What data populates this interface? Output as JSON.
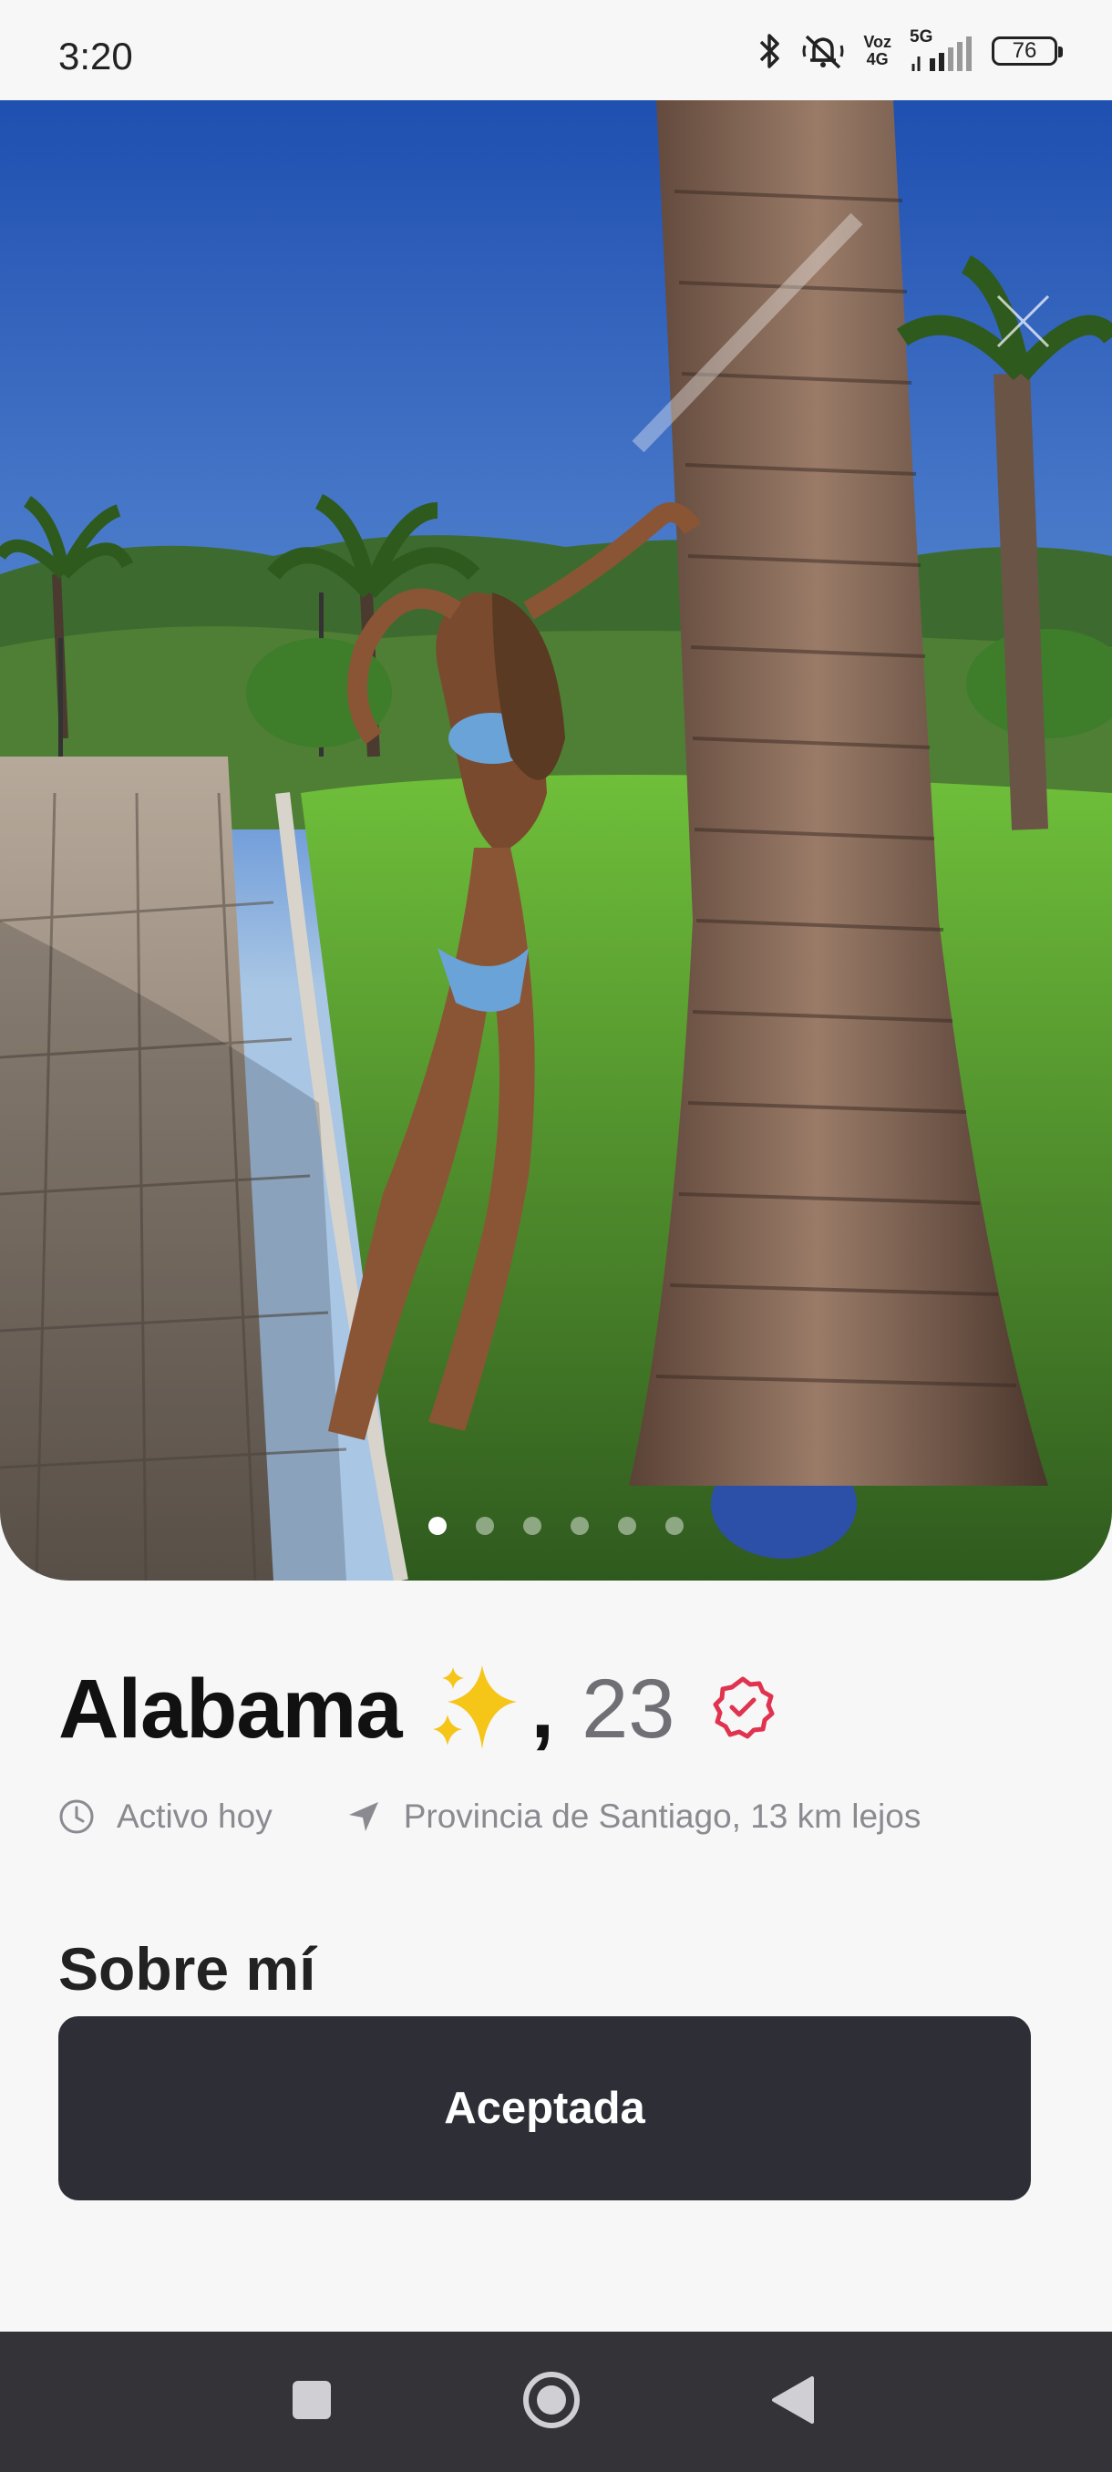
{
  "status_bar": {
    "time": "3:20",
    "network_label_top": "Voz",
    "network_label_bottom": "4G",
    "network_5g": "5G",
    "battery": "76",
    "icons": [
      "bluetooth-icon",
      "mute-icon",
      "signal-icon",
      "battery-icon"
    ]
  },
  "photo": {
    "description_icon": "photo",
    "page_count": 6,
    "active_page": 1
  },
  "profile": {
    "name": "Alabama",
    "emoji": "✨",
    "comma": ",",
    "age": "23",
    "verified_icon": "verified-badge-icon",
    "active": "Activo hoy",
    "location": "Provincia de Santiago, 13 km lejos"
  },
  "about": {
    "title": "Sobre mí",
    "button_label": "Aceptada"
  },
  "colors": {
    "background": "#f7f7f8",
    "button": "#2e2e37",
    "verified": "#e0334f",
    "navbar": "#333338"
  },
  "nav": {
    "icons": [
      "recents-icon",
      "home-icon",
      "back-icon"
    ]
  }
}
